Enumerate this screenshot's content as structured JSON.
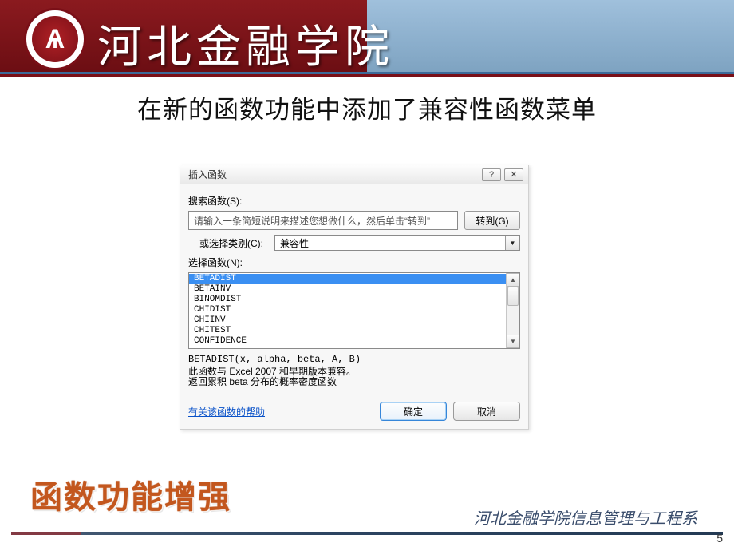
{
  "banner": {
    "school_name": "河北金融学院"
  },
  "headline": "在新的函数功能中添加了兼容性函数菜单",
  "dialog": {
    "title": "插入函数",
    "help_btn": "?",
    "close_btn": "✕",
    "search_label": "搜索函数(S):",
    "search_placeholder": "请输入一条简短说明来描述您想做什么，然后单击“转到”",
    "go_btn": "转到(G)",
    "category_label": "或选择类别(C):",
    "category_value": "兼容性",
    "select_label": "选择函数(N):",
    "functions": [
      "BETADIST",
      "BETAINV",
      "BINOMDIST",
      "CHIDIST",
      "CHIINV",
      "CHITEST",
      "CONFIDENCE"
    ],
    "signature": "BETADIST(x, alpha, beta, A, B)",
    "desc1": "此函数与 Excel 2007 和早期版本兼容。",
    "desc2": "返回累积 beta 分布的概率密度函数",
    "help_link": "有关该函数的帮助",
    "ok_btn": "确定",
    "cancel_btn": "取消"
  },
  "section_title": "函数功能增强",
  "department": "河北金融学院信息管理与工程系",
  "page_number": "5"
}
